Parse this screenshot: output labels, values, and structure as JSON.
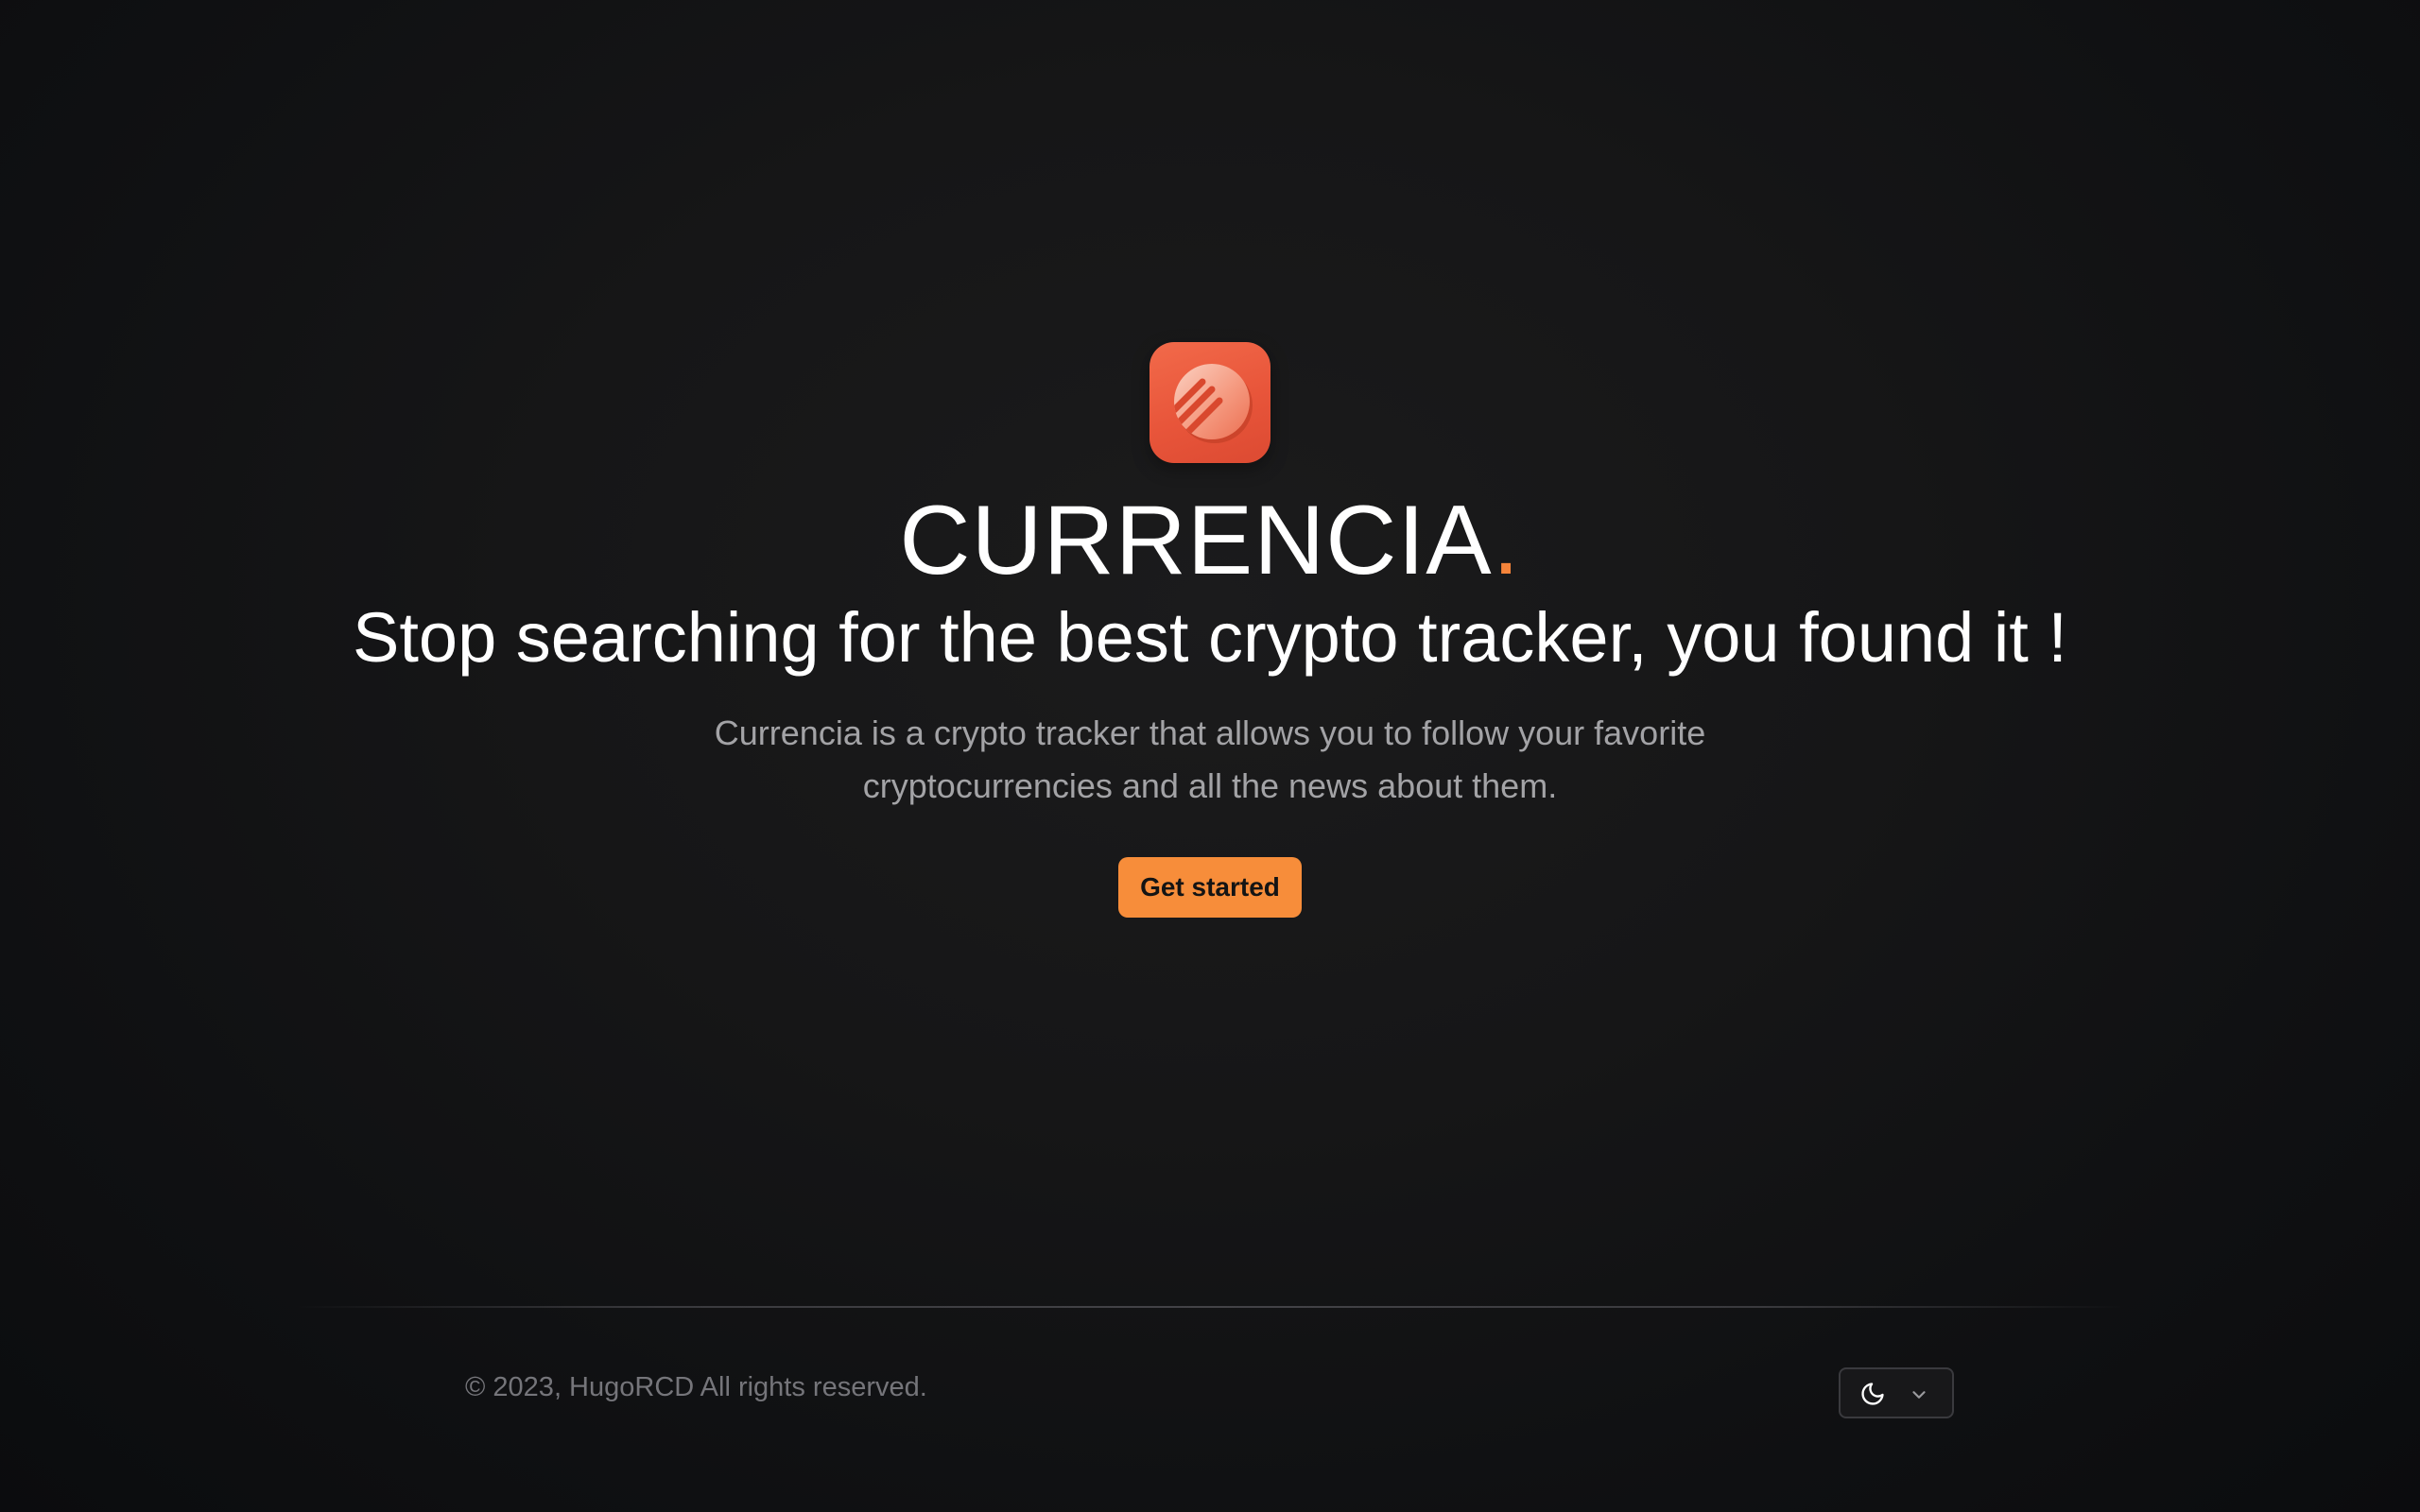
{
  "hero": {
    "brand_name": "CURRENCIA",
    "brand_dot": ".",
    "headline": "Stop searching for the best crypto tracker, you found it !",
    "description": "Currencia is a crypto tracker that allows you to follow your favorite cryptocurrencies and all the news about them.",
    "cta_label": "Get started",
    "logo_icon": "currencia-logo-icon"
  },
  "footer": {
    "copyright": "© 2023, HugoRCD All rights reserved.",
    "theme_selector": {
      "icon": "moon-icon",
      "dropdown_icon": "chevron-down-icon"
    }
  },
  "colors": {
    "accent": "#f78d3a",
    "logo": "#e8553a",
    "background": "#141415",
    "muted_text": "#a3a3a6"
  }
}
